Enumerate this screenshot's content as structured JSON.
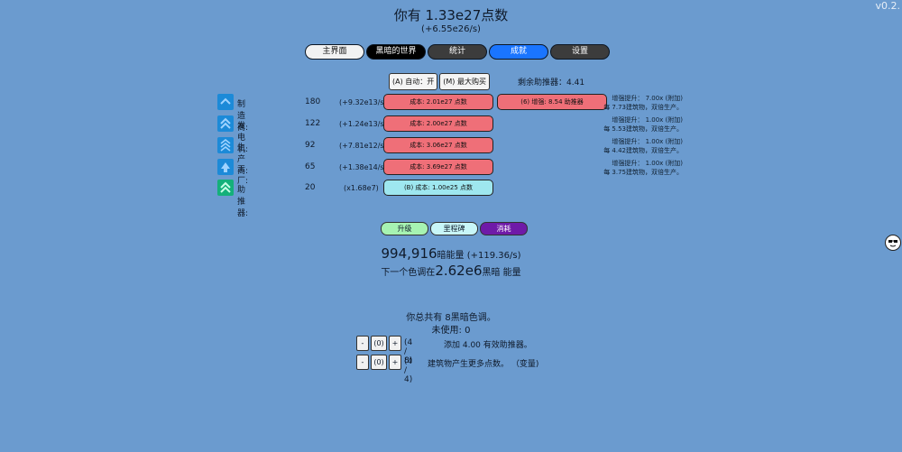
{
  "version": "v0.2.",
  "header": {
    "title": "你有 1.33e27点数",
    "rate": "(+6.55e26/s)"
  },
  "tabs": [
    {
      "label": "主界面",
      "style": "light"
    },
    {
      "label": "黑暗的世界",
      "style": "black"
    },
    {
      "label": "统计",
      "style": "dark"
    },
    {
      "label": "成就",
      "style": "blue"
    },
    {
      "label": "设置",
      "style": "dark"
    }
  ],
  "controls": {
    "auto_label": "(A) 自动：开",
    "max_label": "(M) 最大购买",
    "boosters_left": "剩余助推器：4.41"
  },
  "buildings": [
    {
      "name": "制造商:",
      "amount": "180",
      "prod": "(+9.32e13/s)",
      "cost": "成本: 2.01e27 点数",
      "info1": "增强提升：  7.00x (附加)",
      "info2": "每 7.73建筑物，双倍生产。"
    },
    {
      "name": "发电机:",
      "amount": "122",
      "prod": "(+1.24e13/s)",
      "cost": "成本: 2.00e27 点数",
      "info1": "增强提升：  1.00x (附加)",
      "info2": "每 5.53建筑物，双倍生产。"
    },
    {
      "name": "生产商:",
      "amount": "92",
      "prod": "(+7.81e12/s)",
      "cost": "成本: 3.06e27 点数",
      "info1": "增强提升：  1.00x (附加)",
      "info2": "每 4.42建筑物，双倍生产。"
    },
    {
      "name": "工厂:",
      "amount": "65",
      "prod": "(+1.38e14/s)",
      "cost": "成本: 3.69e27 点数",
      "info1": "增强提升：  1.00x (附加)",
      "info2": "每 3.75建筑物，双倍生产。"
    }
  ],
  "booster": {
    "name": "助推器:",
    "amount": "20",
    "prod": "(x1.68e7)",
    "cost": "(B) 成本: 1.00e25 点数"
  },
  "enhance_button": "(6) 增强: 8.54 助推器",
  "subtabs": [
    {
      "label": "升级",
      "style": "green"
    },
    {
      "label": "里程碑",
      "style": "pale"
    },
    {
      "label": "消耗",
      "style": "purple"
    }
  ],
  "dark": {
    "energy_value": "994,916",
    "energy_unit": "暗能量",
    "energy_rate": "(+119.36/s)",
    "next_prefix": "下一个色调在",
    "next_value": "2.62e6",
    "next_suffix": "黑暗 能量"
  },
  "tones": {
    "total": "你总共有 8黑暗色调。",
    "unused": "未使用: 0",
    "rows": [
      {
        "minus": "-",
        "count": "(0)",
        "plus": "+",
        "ratio": "(4 / 8)",
        "desc": "添加 4.00 有效助推器。"
      },
      {
        "minus": "-",
        "count": "(0)",
        "plus": "+",
        "ratio": "(4 / 4)",
        "desc": "建筑物产生更多点数。 （变量)"
      }
    ]
  },
  "colors": {
    "bg": "#6b9bcf",
    "buy_red": "#ef6f78",
    "buy_cyan": "#9ee7ef",
    "icon_blue": "#1c8ad8",
    "icon_green": "#14b07a"
  }
}
